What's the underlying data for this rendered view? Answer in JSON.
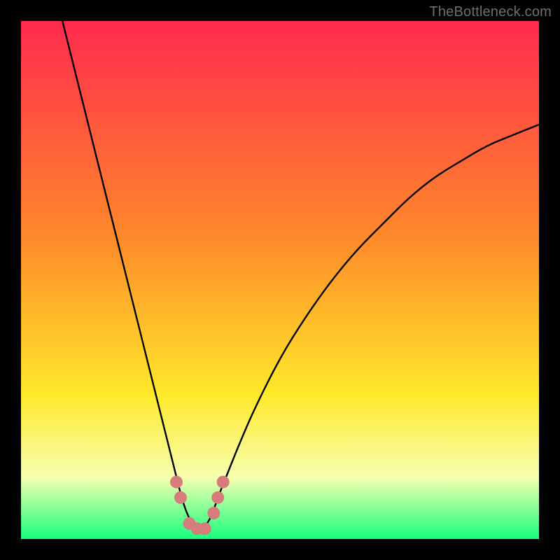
{
  "watermark": "TheBottleneck.com",
  "gradient": {
    "top_color": "#ff2b4d",
    "mid1_color": "#ff8a2a",
    "mid2_color": "#ffe92a",
    "band_color": "#f7ffb0",
    "bottom_color": "#17ff7d"
  },
  "chart_data": {
    "type": "line",
    "title": "",
    "xlabel": "",
    "ylabel": "",
    "xlim_pct": [
      0,
      100
    ],
    "ylim_pct": [
      0,
      100
    ],
    "series": [
      {
        "name": "bottleneck-curve",
        "x_pct": [
          8,
          10,
          12,
          14,
          16,
          18,
          20,
          22,
          24,
          26,
          28,
          30,
          31,
          32,
          33,
          34,
          35,
          36,
          37,
          38,
          40,
          42,
          45,
          50,
          55,
          60,
          65,
          70,
          75,
          80,
          85,
          90,
          95,
          100
        ],
        "y_pct": [
          100,
          92,
          84,
          76,
          68,
          60,
          52,
          44,
          36,
          28,
          20,
          12,
          8,
          5,
          3,
          2,
          2,
          3,
          5,
          8,
          13,
          18,
          25,
          35,
          43,
          50,
          56,
          61,
          66,
          70,
          73,
          76,
          78,
          80
        ]
      }
    ],
    "markers": {
      "name": "highlight-points",
      "x_pct": [
        30.0,
        30.8,
        32.5,
        34.0,
        35.5,
        37.2,
        38.0,
        39.0
      ],
      "y_pct": [
        11.0,
        8.0,
        3.0,
        2.0,
        2.0,
        5.0,
        8.0,
        11.0
      ]
    }
  }
}
